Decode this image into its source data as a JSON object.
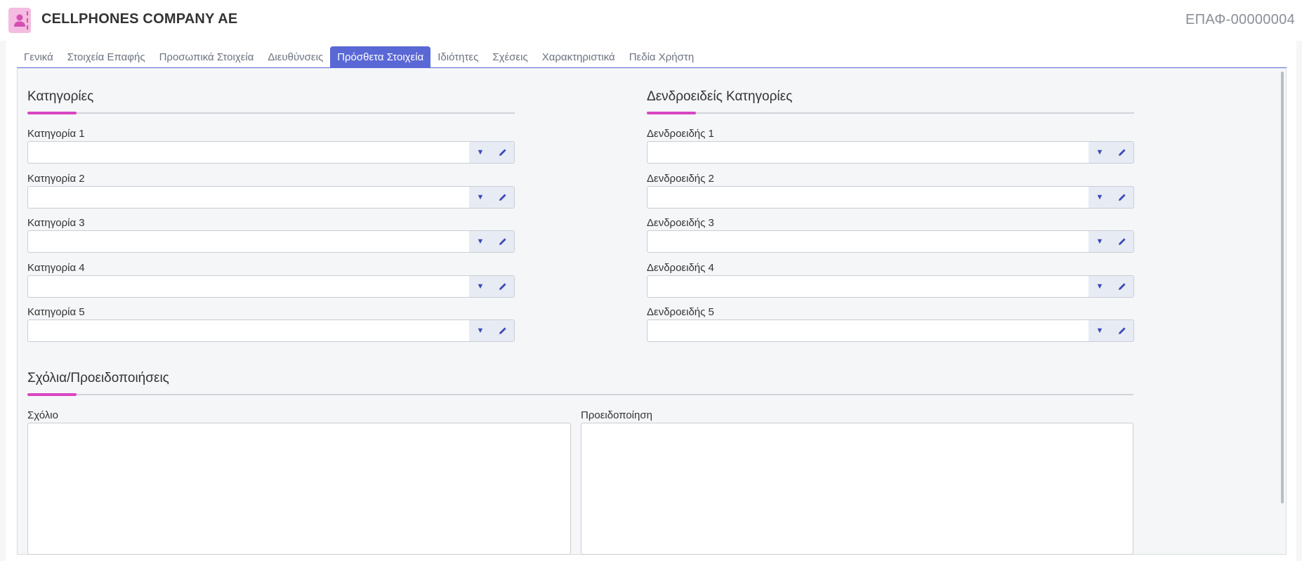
{
  "header": {
    "title": "CELLPHONES COMPANY AE",
    "code": "ΕΠΑΦ-00000004",
    "icon": "contact-person-icon"
  },
  "tabs": [
    {
      "label": "Γενικά"
    },
    {
      "label": "Στοιχεία Επαφής"
    },
    {
      "label": "Προσωπικά Στοιχεία"
    },
    {
      "label": "Διευθύνσεις"
    },
    {
      "label": "Πρόσθετα Στοιχεία",
      "active": true
    },
    {
      "label": "Ιδιότητες"
    },
    {
      "label": "Σχέσεις"
    },
    {
      "label": "Χαρακτηριστικά"
    },
    {
      "label": "Πεδία Χρήστη"
    }
  ],
  "categories": {
    "title": "Κατηγορίες",
    "fields": [
      {
        "label": "Κατηγορία 1",
        "value": ""
      },
      {
        "label": "Κατηγορία 2",
        "value": ""
      },
      {
        "label": "Κατηγορία 3",
        "value": ""
      },
      {
        "label": "Κατηγορία 4",
        "value": ""
      },
      {
        "label": "Κατηγορία 5",
        "value": ""
      }
    ]
  },
  "tree_categories": {
    "title": "Δενδροειδείς Κατηγορίες",
    "fields": [
      {
        "label": "Δενδροειδής 1",
        "value": ""
      },
      {
        "label": "Δενδροειδής 2",
        "value": ""
      },
      {
        "label": "Δενδροειδής 3",
        "value": ""
      },
      {
        "label": "Δενδροειδής 4",
        "value": ""
      },
      {
        "label": "Δενδροειδής 5",
        "value": ""
      }
    ]
  },
  "comments": {
    "title": "Σχόλια/Προειδοποιήσεις",
    "comment_label": "Σχόλιο",
    "comment_value": "",
    "warning_label": "Προειδοποίηση",
    "warning_value": ""
  },
  "colors": {
    "accent": "#5a68d6",
    "section_accent": "#d946c3",
    "avatar_bg": "#f4bce0"
  }
}
